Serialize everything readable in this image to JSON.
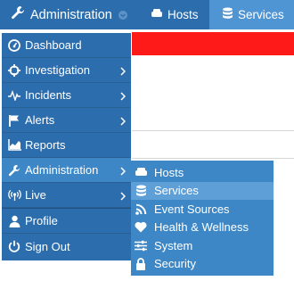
{
  "topbar": {
    "brand_label": "Administration",
    "tabs": [
      {
        "label": "Hosts"
      },
      {
        "label": "Services"
      }
    ]
  },
  "menu": {
    "items": [
      {
        "label": "Dashboard",
        "icon": "dashboard-icon"
      },
      {
        "label": "Investigation",
        "icon": "crosshair-icon"
      },
      {
        "label": "Incidents",
        "icon": "pulse-icon"
      },
      {
        "label": "Alerts",
        "icon": "flag-icon"
      },
      {
        "label": "Reports",
        "icon": "chart-icon"
      },
      {
        "label": "Administration",
        "icon": "wrench-icon"
      },
      {
        "label": "Live",
        "icon": "broadcast-icon"
      },
      {
        "label": "Profile",
        "icon": "user-icon"
      },
      {
        "label": "Sign Out",
        "icon": "power-icon"
      }
    ]
  },
  "submenu": {
    "items": [
      {
        "label": "Hosts",
        "icon": "server-icon"
      },
      {
        "label": "Services",
        "icon": "database-icon"
      },
      {
        "label": "Event Sources",
        "icon": "rss-icon"
      },
      {
        "label": "Health & Wellness",
        "icon": "heart-icon"
      },
      {
        "label": "System",
        "icon": "sliders-icon"
      },
      {
        "label": "Security",
        "icon": "lock-icon"
      }
    ]
  },
  "colors": {
    "nav_bg": "#2b6dad",
    "active_bg": "#3d87c6",
    "submenu_active": "#5f9fd8",
    "alert_red": "#ff1a1a"
  }
}
